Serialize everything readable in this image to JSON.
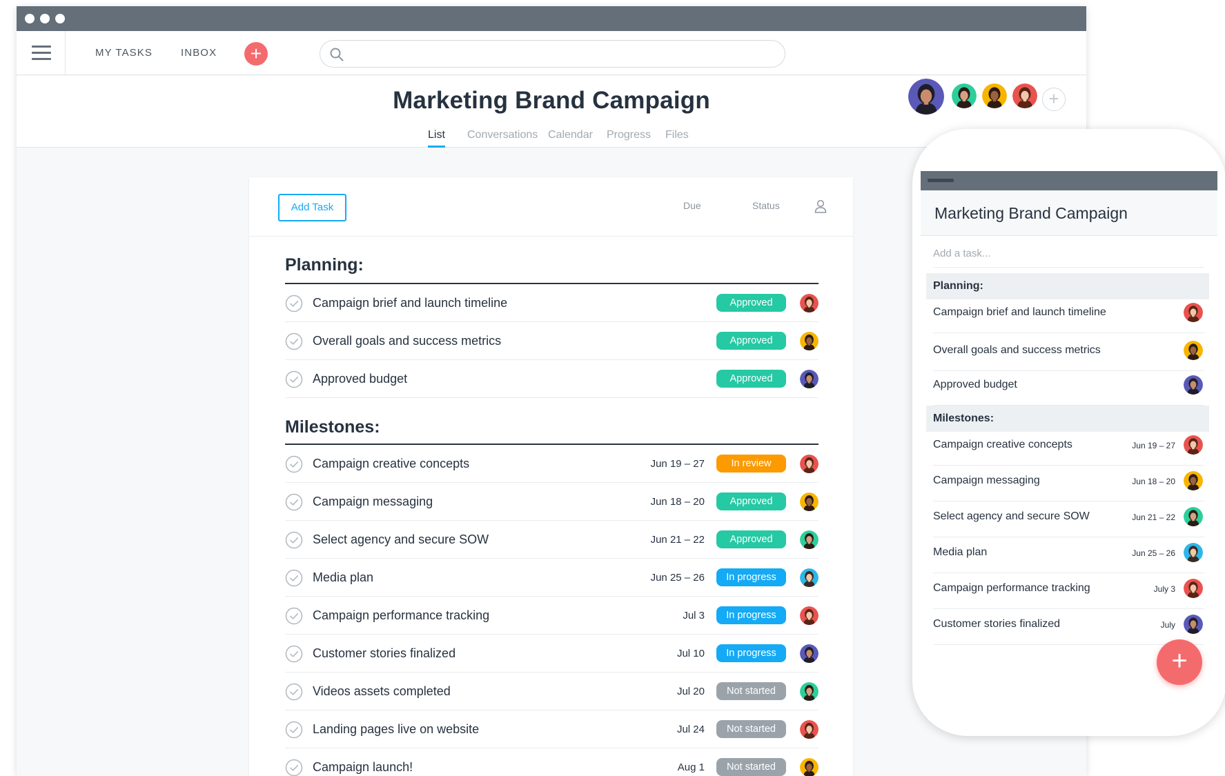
{
  "nav": {
    "my_tasks": "MY TASKS",
    "inbox": "INBOX",
    "add_label": "+",
    "search_value": ""
  },
  "project": {
    "title": "Marketing Brand Campaign",
    "tabs": [
      "List",
      "Conversations",
      "Calendar",
      "Progress",
      "Files"
    ],
    "active_tab": "List",
    "add_member": "+"
  },
  "list": {
    "add_task_label": "Add Task",
    "columns": {
      "due": "Due",
      "status": "Status"
    },
    "sections": [
      {
        "title": "Planning:",
        "tasks": [
          {
            "name": "Campaign brief and launch timeline",
            "due": "",
            "status": "Approved",
            "status_color": "#25c9a3",
            "avatar": "red"
          },
          {
            "name": "Overall goals and success metrics",
            "due": "",
            "status": "Approved",
            "status_color": "#25c9a3",
            "avatar": "orange"
          },
          {
            "name": "Approved budget",
            "due": "",
            "status": "Approved",
            "status_color": "#25c9a3",
            "avatar": "purple"
          }
        ]
      },
      {
        "title": "Milestones:",
        "tasks": [
          {
            "name": "Campaign creative concepts",
            "due": "Jun 19 – 27",
            "status": "In review",
            "status_color": "#fd9a00",
            "avatar": "red"
          },
          {
            "name": "Campaign messaging",
            "due": "Jun 18 – 20",
            "status": "Approved",
            "status_color": "#25c9a3",
            "avatar": "orange"
          },
          {
            "name": "Select agency and secure SOW",
            "due": "Jun 21 – 22",
            "status": "Approved",
            "status_color": "#25c9a3",
            "avatar": "teal"
          },
          {
            "name": "Media plan",
            "due": "Jun 25 – 26",
            "status": "In progress",
            "status_color": "#14aaf5",
            "avatar": "cyan"
          },
          {
            "name": "Campaign performance tracking",
            "due": "Jul 3",
            "status": "In progress",
            "status_color": "#14aaf5",
            "avatar": "red"
          },
          {
            "name": "Customer stories finalized",
            "due": "Jul 10",
            "status": "In progress",
            "status_color": "#14aaf5",
            "avatar": "purple"
          },
          {
            "name": "Videos assets completed",
            "due": "Jul 20",
            "status": "Not started",
            "status_color": "#9aa3aa",
            "avatar": "teal"
          },
          {
            "name": "Landing pages live on website",
            "due": "Jul 24",
            "status": "Not started",
            "status_color": "#9aa3aa",
            "avatar": "red"
          },
          {
            "name": "Campaign launch!",
            "due": "Aug 1",
            "status": "Not started",
            "status_color": "#9aa3aa",
            "avatar": "orange"
          }
        ]
      }
    ]
  },
  "mobile": {
    "title": "Marketing Brand Campaign",
    "add_task_placeholder": "Add a task...",
    "sections": [
      {
        "title": "Planning:",
        "tasks": [
          {
            "name": "Campaign brief and launch timeline",
            "due": "",
            "avatar": "red"
          },
          {
            "name": "Overall goals and success metrics",
            "due": "",
            "avatar": "orange"
          },
          {
            "name": "Approved budget",
            "due": "",
            "avatar": "purple"
          }
        ]
      },
      {
        "title": "Milestones:",
        "tasks": [
          {
            "name": "Campaign creative concepts",
            "due": "Jun 19 – 27",
            "avatar": "red"
          },
          {
            "name": "Campaign messaging",
            "due": "Jun 18 – 20",
            "avatar": "orange"
          },
          {
            "name": "Select agency and secure SOW",
            "due": "Jun 21 – 22",
            "avatar": "teal"
          },
          {
            "name": "Media plan",
            "due": "Jun 25 – 26",
            "avatar": "cyan"
          },
          {
            "name": "Campaign performance tracking",
            "due": "July 3",
            "avatar": "red"
          },
          {
            "name": "Customer stories finalized",
            "due": "July",
            "avatar": "purple"
          }
        ]
      }
    ],
    "fab_label": "+"
  },
  "colors": {
    "accent": "#14aaf5",
    "brand_coral": "#f46b6e",
    "titlebar": "#646f79",
    "approved": "#25c9a3",
    "in_review": "#fd9a00",
    "in_progress": "#14aaf5",
    "not_started": "#9aa3aa"
  },
  "avatar_palette": {
    "red": {
      "bg": "#e8534f",
      "hair": "#5a2417",
      "skin": "#f2c6a8"
    },
    "orange": {
      "bg": "#f7b500",
      "hair": "#2d1b13",
      "skin": "#9a6242"
    },
    "purple": {
      "bg": "#5a59b8",
      "hair": "#1e1e2a",
      "skin": "#c98c6c"
    },
    "teal": {
      "bg": "#2ccf9a",
      "hair": "#2a1d16",
      "skin": "#d6a182"
    },
    "cyan": {
      "bg": "#2eb6e9",
      "hair": "#3b2b21",
      "skin": "#f1c9a5"
    }
  },
  "header_avatars": [
    "purple",
    "teal",
    "orange",
    "red"
  ]
}
